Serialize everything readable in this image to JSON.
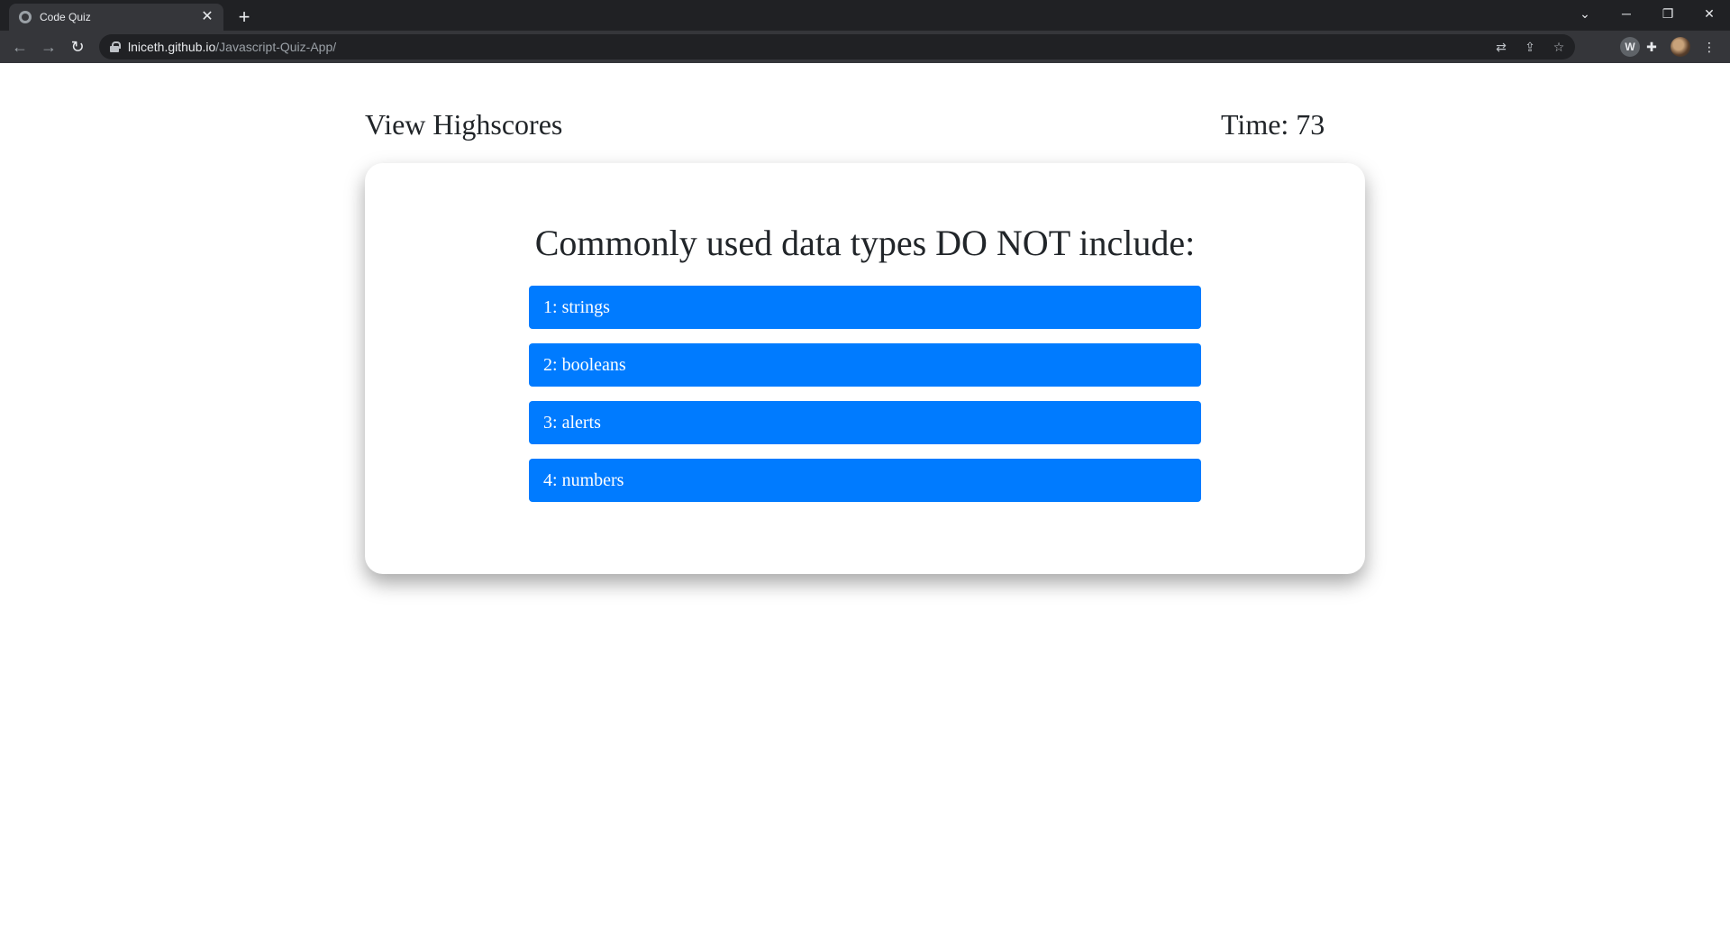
{
  "browser": {
    "tab_title": "Code Quiz",
    "url_host": "lniceth.github.io",
    "url_path": "/Javascript-Quiz-App/",
    "icons": {
      "tab": "globe-icon",
      "close": "close-icon",
      "new_tab": "plus-icon",
      "back": "back-arrow-icon",
      "forward": "forward-arrow-icon",
      "reload": "reload-icon",
      "lock": "lock-icon",
      "translate": "translate-icon",
      "share": "share-icon",
      "bookmark": "star-icon",
      "extensions": "puzzle-icon",
      "menu": "kebab-menu-icon"
    },
    "colors": {
      "chrome_dark": "#202124",
      "chrome_tab": "#35363a"
    }
  },
  "header": {
    "highscores_label": "View Highscores",
    "time_label": "Time:",
    "time_value": "73"
  },
  "quiz": {
    "question": "Commonly used data types DO NOT include:",
    "answers": [
      {
        "number": "1",
        "text": "strings"
      },
      {
        "number": "2",
        "text": "booleans"
      },
      {
        "number": "3",
        "text": "alerts"
      },
      {
        "number": "4",
        "text": "numbers"
      }
    ],
    "colors": {
      "button": "#007bff",
      "button_text": "#ffffff"
    }
  }
}
